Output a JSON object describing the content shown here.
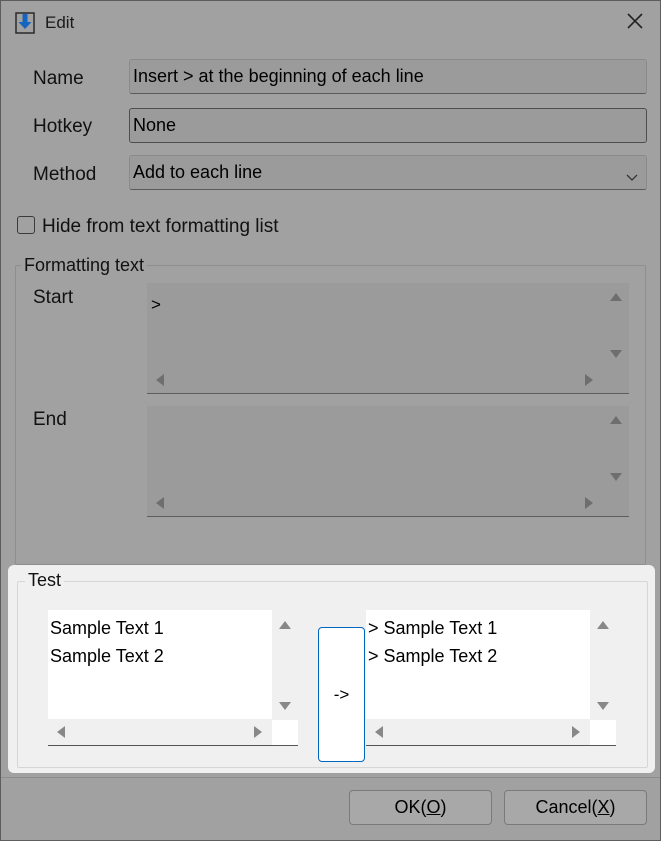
{
  "window": {
    "title": "Edit",
    "app_icon": "download-arrow-icon",
    "close_icon": "close-icon"
  },
  "form": {
    "name_label": "Name",
    "name_value": "Insert > at the beginning of each line",
    "hotkey_label": "Hotkey",
    "hotkey_value": "None",
    "method_label": "Method",
    "method_value": "Add to each line",
    "hide_label": "Hide from text formatting list",
    "hide_checked": false
  },
  "formatting": {
    "group_title": "Formatting text",
    "start_label": "Start",
    "start_value": ">",
    "end_label": "End",
    "end_value": ""
  },
  "test": {
    "group_title": "Test",
    "input_lines": "Sample Text 1\nSample Text 2",
    "convert_label": "->",
    "output_lines": "> Sample Text 1\n> Sample Text 2"
  },
  "footer": {
    "ok_text": "OK(",
    "ok_mnemonic": "O",
    "ok_close": ")",
    "cancel_text": "Cancel(",
    "cancel_mnemonic": "X",
    "cancel_close": ")"
  },
  "colors": {
    "dimmed_background": "#a1a1a1",
    "active_panel": "#f0f0f0",
    "accent": "#0067c0",
    "icon_blue": "#1565c0"
  }
}
